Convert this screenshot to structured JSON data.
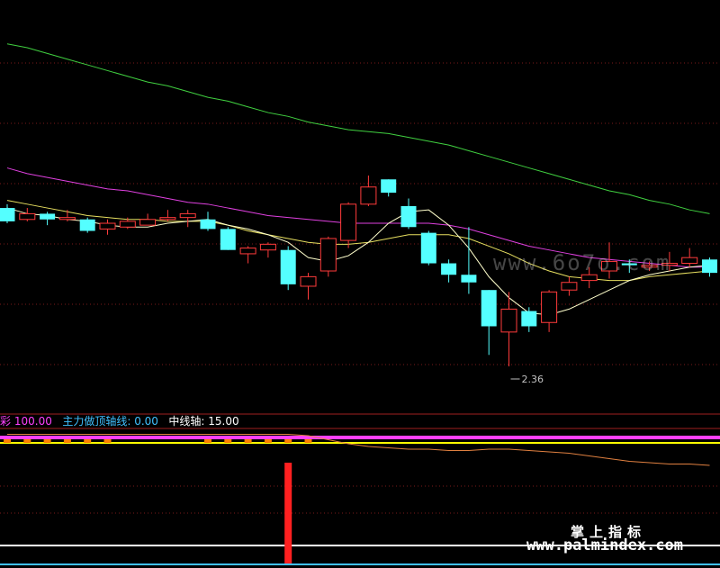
{
  "indicator": {
    "val1_label": "彩",
    "val1": "100.00",
    "val2_label": "主力做顶轴线:",
    "val2": "0.00",
    "val3_label": "中线轴:",
    "val3": "15.00"
  },
  "watermark": {
    "cn": "掌上指标",
    "url": "www.palmindex.com",
    "faint": "www.6o7o.com"
  },
  "chart_data": {
    "type": "candlestick",
    "low_annotation": "2.36",
    "colors": {
      "up": "#ff3b3b",
      "down": "#54ffff",
      "ma_short": "#ffffcc",
      "ma_mid": "#e8e060",
      "ma_long": "#e040e0",
      "ma_longest": "#40d040",
      "ind_bar": "#ff2020",
      "ind_yellow": "#ffff00",
      "ind_magenta": "#ff40ff",
      "ind_orange": "#e08040",
      "ind_white": "#ffffff",
      "ind_cyan": "#40c0ff"
    },
    "candles": [
      {
        "o": 3.36,
        "c": 3.29,
        "h": 3.38,
        "l": 3.28
      },
      {
        "o": 3.3,
        "c": 3.33,
        "h": 3.36,
        "l": 3.29
      },
      {
        "o": 3.33,
        "c": 3.3,
        "h": 3.34,
        "l": 3.27
      },
      {
        "o": 3.3,
        "c": 3.31,
        "h": 3.35,
        "l": 3.29
      },
      {
        "o": 3.3,
        "c": 3.24,
        "h": 3.31,
        "l": 3.23
      },
      {
        "o": 3.25,
        "c": 3.28,
        "h": 3.3,
        "l": 3.22
      },
      {
        "o": 3.26,
        "c": 3.29,
        "h": 3.31,
        "l": 3.25
      },
      {
        "o": 3.27,
        "c": 3.3,
        "h": 3.33,
        "l": 3.27
      },
      {
        "o": 3.3,
        "c": 3.31,
        "h": 3.35,
        "l": 3.29
      },
      {
        "o": 3.31,
        "c": 3.33,
        "h": 3.35,
        "l": 3.26
      },
      {
        "o": 3.3,
        "c": 3.25,
        "h": 3.34,
        "l": 3.24
      },
      {
        "o": 3.25,
        "c": 3.14,
        "h": 3.26,
        "l": 3.14
      },
      {
        "o": 3.12,
        "c": 3.15,
        "h": 3.16,
        "l": 3.07
      },
      {
        "o": 3.14,
        "c": 3.17,
        "h": 3.18,
        "l": 3.1
      },
      {
        "o": 3.14,
        "c": 2.96,
        "h": 3.16,
        "l": 2.93
      },
      {
        "o": 2.95,
        "c": 3.0,
        "h": 3.02,
        "l": 2.88
      },
      {
        "o": 3.03,
        "c": 3.2,
        "h": 3.21,
        "l": 3.0
      },
      {
        "o": 3.19,
        "c": 3.38,
        "h": 3.39,
        "l": 3.15
      },
      {
        "o": 3.38,
        "c": 3.47,
        "h": 3.53,
        "l": 3.37
      },
      {
        "o": 3.51,
        "c": 3.44,
        "h": 3.51,
        "l": 3.42
      },
      {
        "o": 3.37,
        "c": 3.26,
        "h": 3.41,
        "l": 3.25
      },
      {
        "o": 3.23,
        "c": 3.07,
        "h": 3.24,
        "l": 3.06
      },
      {
        "o": 3.07,
        "c": 3.01,
        "h": 3.09,
        "l": 2.97
      },
      {
        "o": 3.01,
        "c": 2.97,
        "h": 3.26,
        "l": 2.91
      },
      {
        "o": 2.93,
        "c": 2.74,
        "h": 2.93,
        "l": 2.59
      },
      {
        "o": 2.71,
        "c": 2.83,
        "h": 2.92,
        "l": 2.53
      },
      {
        "o": 2.82,
        "c": 2.74,
        "h": 2.84,
        "l": 2.71
      },
      {
        "o": 2.76,
        "c": 2.92,
        "h": 2.93,
        "l": 2.71
      },
      {
        "o": 2.93,
        "c": 2.97,
        "h": 3.0,
        "l": 2.9
      },
      {
        "o": 2.98,
        "c": 3.01,
        "h": 3.05,
        "l": 2.94
      },
      {
        "o": 3.03,
        "c": 3.08,
        "h": 3.18,
        "l": 2.99
      },
      {
        "o": 3.07,
        "c": 3.06,
        "h": 3.09,
        "l": 3.02
      },
      {
        "o": 3.05,
        "c": 3.06,
        "h": 3.08,
        "l": 3.03
      },
      {
        "o": 3.06,
        "c": 3.07,
        "h": 3.13,
        "l": 3.03
      },
      {
        "o": 3.07,
        "c": 3.1,
        "h": 3.15,
        "l": 3.05
      },
      {
        "o": 3.09,
        "c": 3.02,
        "h": 3.1,
        "l": 3.0
      }
    ],
    "ma_short": [
      3.36,
      3.33,
      3.32,
      3.3,
      3.29,
      3.27,
      3.26,
      3.26,
      3.28,
      3.29,
      3.3,
      3.27,
      3.25,
      3.22,
      3.18,
      3.1,
      3.08,
      3.11,
      3.18,
      3.28,
      3.34,
      3.35,
      3.27,
      3.15,
      3.0,
      2.89,
      2.81,
      2.8,
      2.83,
      2.88,
      2.93,
      2.98,
      3.01,
      3.03,
      3.05,
      3.06
    ],
    "ma_mid": [
      3.4,
      3.38,
      3.36,
      3.34,
      3.32,
      3.31,
      3.3,
      3.3,
      3.29,
      3.29,
      3.29,
      3.27,
      3.24,
      3.22,
      3.2,
      3.18,
      3.17,
      3.17,
      3.18,
      3.2,
      3.22,
      3.22,
      3.22,
      3.2,
      3.16,
      3.12,
      3.07,
      3.03,
      3.0,
      2.99,
      2.98,
      2.98,
      3.0,
      3.01,
      3.02,
      3.03
    ],
    "ma_long": [
      3.57,
      3.54,
      3.52,
      3.5,
      3.48,
      3.46,
      3.45,
      3.43,
      3.41,
      3.39,
      3.38,
      3.36,
      3.34,
      3.32,
      3.31,
      3.3,
      3.29,
      3.28,
      3.28,
      3.28,
      3.28,
      3.28,
      3.27,
      3.25,
      3.22,
      3.19,
      3.16,
      3.14,
      3.12,
      3.1,
      3.09,
      3.08,
      3.07,
      3.06,
      3.05,
      3.05
    ],
    "ma_longest": [
      4.22,
      4.2,
      4.17,
      4.14,
      4.11,
      4.08,
      4.05,
      4.02,
      4.0,
      3.97,
      3.94,
      3.92,
      3.89,
      3.86,
      3.84,
      3.81,
      3.79,
      3.77,
      3.76,
      3.75,
      3.73,
      3.71,
      3.69,
      3.66,
      3.63,
      3.6,
      3.57,
      3.54,
      3.51,
      3.48,
      3.45,
      3.43,
      3.4,
      3.38,
      3.35,
      3.33
    ],
    "ind_spike_index": 14,
    "ind_orange": [
      97,
      97,
      97,
      97,
      97,
      97,
      97,
      97,
      97,
      97,
      97,
      97,
      97,
      97,
      97,
      96,
      93,
      90,
      88,
      87,
      86,
      86,
      85,
      85,
      86,
      86,
      85,
      84,
      83,
      81,
      79,
      77,
      76,
      75,
      75,
      74
    ],
    "ind_marks": [
      1,
      1,
      1,
      1,
      1,
      1,
      0,
      0,
      0,
      0,
      1,
      1,
      1,
      1,
      1,
      1,
      0,
      0,
      0,
      0,
      0,
      0,
      0,
      0,
      0,
      0,
      0,
      0,
      0,
      0,
      0,
      0,
      0,
      0,
      0,
      0
    ]
  }
}
